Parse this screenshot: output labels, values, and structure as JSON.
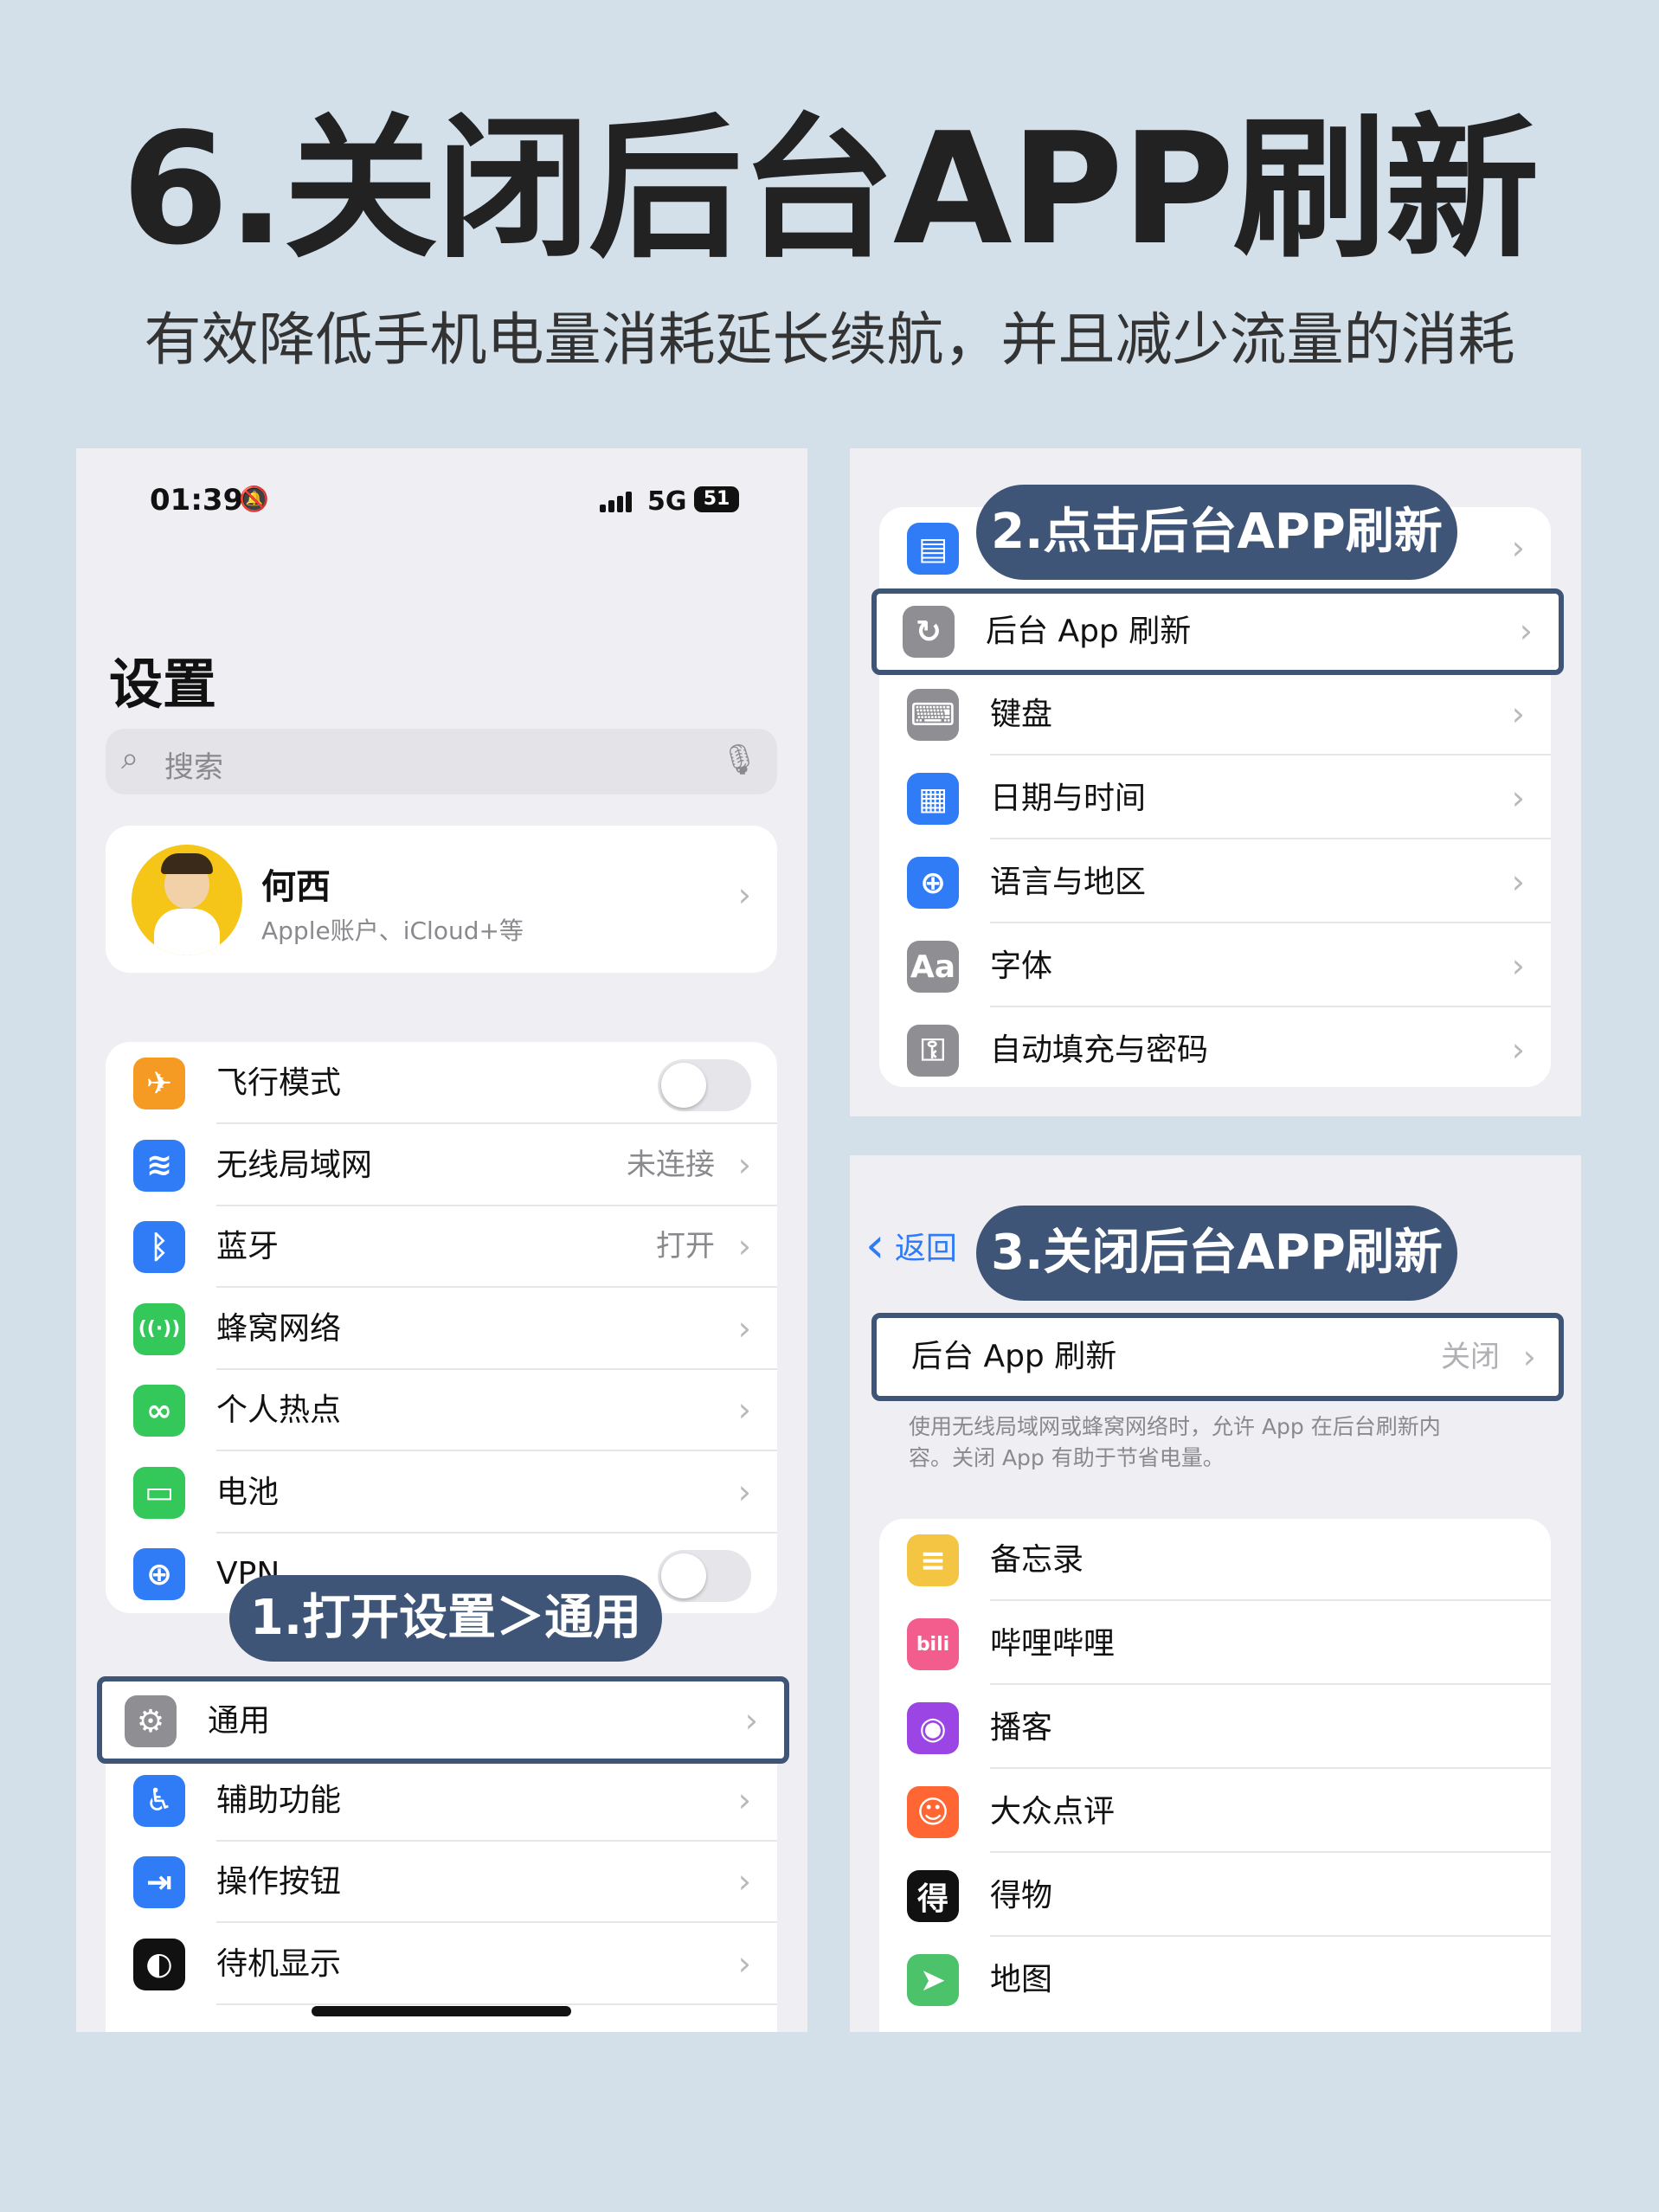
{
  "header": {
    "title": "6.关闭后台APP刷新",
    "subtitle": "有效降低手机电量消耗延长续航，并且减少流量的消耗"
  },
  "left": {
    "status": {
      "time": "01:39",
      "network": "5G",
      "battery": "51"
    },
    "page_title": "设置",
    "search_placeholder": "搜索",
    "profile": {
      "name": "何西",
      "sub": "Apple账户、iCloud+等"
    },
    "rows": [
      {
        "label": "飞行模式",
        "color": "#f59a23",
        "icon": "airplane-icon",
        "glyph": "✈"
      },
      {
        "label": "无线局域网",
        "value": "未连接",
        "color": "#2f7cf6",
        "icon": "wifi-icon",
        "glyph": "≋"
      },
      {
        "label": "蓝牙",
        "value": "打开",
        "color": "#2f7cf6",
        "icon": "bluetooth-icon",
        "glyph": "ᛒ"
      },
      {
        "label": "蜂窝网络",
        "color": "#34c759",
        "icon": "cellular-icon",
        "glyph": "((·))"
      },
      {
        "label": "个人热点",
        "color": "#34c759",
        "icon": "hotspot-icon",
        "glyph": "∞"
      },
      {
        "label": "电池",
        "color": "#34c759",
        "icon": "battery-icon",
        "glyph": "▭"
      },
      {
        "label": "VPN",
        "color": "#2f7cf6",
        "icon": "vpn-icon",
        "glyph": "⊕"
      }
    ],
    "step1": "1.打开设置＞通用",
    "rows2": [
      {
        "label": "通用",
        "color": "#8e8e93",
        "icon": "gear-icon",
        "glyph": "⚙"
      },
      {
        "label": "辅助功能",
        "color": "#2f7cf6",
        "icon": "accessibility-icon",
        "glyph": "♿"
      },
      {
        "label": "操作按钮",
        "color": "#2f7cf6",
        "icon": "action-button-icon",
        "glyph": "⇥"
      },
      {
        "label": "待机显示",
        "color": "#111111",
        "icon": "standby-icon",
        "glyph": "◐"
      }
    ]
  },
  "r1": {
    "step2": "2.点击后台APP刷新",
    "rows": [
      {
        "label": "后台 App 刷新",
        "color": "#8e8e93",
        "icon": "refresh-icon",
        "glyph": "↻"
      },
      {
        "label": "键盘",
        "color": "#8e8e93",
        "icon": "keyboard-icon",
        "glyph": "⌨"
      },
      {
        "label": "日期与时间",
        "color": "#2f7cf6",
        "icon": "calendar-icon",
        "glyph": "▦"
      },
      {
        "label": "语言与地区",
        "color": "#2f7cf6",
        "icon": "globe-icon",
        "glyph": "⊕"
      },
      {
        "label": "字体",
        "color": "#8e8e93",
        "icon": "font-icon",
        "glyph": "Aa"
      },
      {
        "label": "自动填充与密码",
        "color": "#8e8e93",
        "icon": "key-icon",
        "glyph": "⚿"
      }
    ]
  },
  "r2": {
    "back": "返回",
    "step3": "3.关闭后台APP刷新",
    "setting": {
      "label": "后台 App 刷新",
      "value": "关闭"
    },
    "note": "使用无线局域网或蜂窝网络时，允许 App 在后台刷新内容。关闭 App 有助于节省电量。",
    "apps": [
      {
        "label": "备忘录",
        "color": "#f4c542",
        "icon": "notes-icon",
        "glyph": "≡"
      },
      {
        "label": "哔哩哔哩",
        "color": "#f25d8e",
        "icon": "bilibili-icon",
        "glyph": "bili"
      },
      {
        "label": "播客",
        "color": "#9b45e4",
        "icon": "podcast-icon",
        "glyph": "◉"
      },
      {
        "label": "大众点评",
        "color": "#ff6633",
        "icon": "dianping-icon",
        "glyph": "☺"
      },
      {
        "label": "得物",
        "color": "#111111",
        "icon": "dewu-icon",
        "glyph": "得"
      },
      {
        "label": "地图",
        "color": "#4cc36b",
        "icon": "maps-icon",
        "glyph": "➤"
      }
    ]
  },
  "common": {
    "chevron": "›",
    "back_chevron": "‹"
  }
}
